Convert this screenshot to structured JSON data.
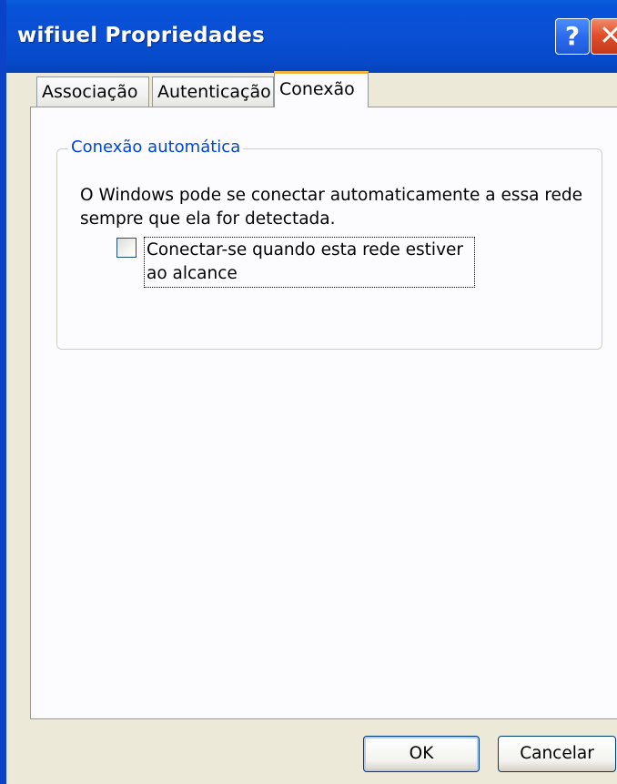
{
  "window": {
    "title": "wifiuel Propriedades",
    "help_label": "?",
    "close_label": "✕"
  },
  "tabs": [
    {
      "label": "Associação",
      "active": false
    },
    {
      "label": "Autenticação",
      "active": false
    },
    {
      "label": "Conexão",
      "active": true
    }
  ],
  "group": {
    "legend": "Conexão automática",
    "description": "O Windows pode se conectar automaticamente a essa rede sempre que ela for detectada.",
    "checkbox": {
      "label": "Conectar-se quando esta rede estiver ao alcance",
      "checked": false
    }
  },
  "buttons": {
    "ok_label": "OK",
    "cancel_label": "Cancelar"
  }
}
